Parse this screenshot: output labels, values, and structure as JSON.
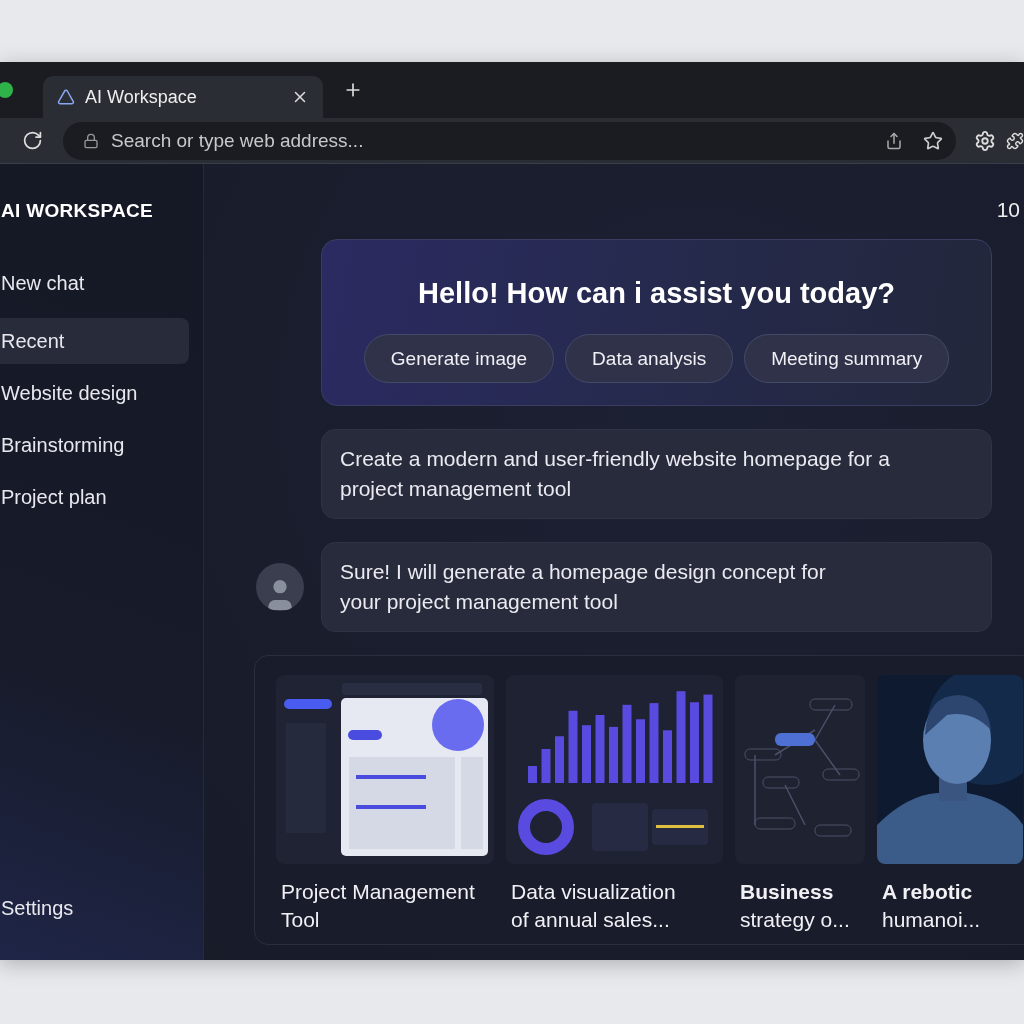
{
  "browser": {
    "tab": {
      "title": "AI Workspace",
      "selected": true
    },
    "address_bar": {
      "placeholder": "Search or type web address..."
    }
  },
  "sidebar": {
    "title": "AI WORKSPACE",
    "items": [
      {
        "label": "New chat",
        "selected": false
      },
      {
        "label": "Recent",
        "selected": true
      },
      {
        "label": "Website design",
        "selected": false
      },
      {
        "label": "Brainstorming",
        "selected": false
      },
      {
        "label": "Project plan",
        "selected": false
      }
    ],
    "footer_item": {
      "label": "Settings",
      "selected": false
    }
  },
  "header": {
    "counter": "10"
  },
  "hero": {
    "title": "Hello! How can i assist you today?",
    "suggestions": [
      "Generate image",
      "Data analysis",
      "Meeting summary"
    ]
  },
  "messages": [
    {
      "kind": "user",
      "lines": [
        "Create a modern and user-friendly website homepage for a",
        "project management tool"
      ]
    },
    {
      "kind": "assistant",
      "lines": [
        "Sure! I will generate a homepage design concept for",
        "your project management tool"
      ]
    }
  ],
  "gallery": [
    {
      "kind": "dashboard",
      "lines": [
        "Project Management",
        "Tool"
      ]
    },
    {
      "kind": "chart",
      "lines": [
        "Data visualization",
        "of annual sales..."
      ]
    },
    {
      "kind": "diagram",
      "lines": [
        "**Business**",
        "strategy o..."
      ]
    },
    {
      "kind": "figure",
      "lines": [
        "**A rebotic**",
        "humanoi..."
      ]
    }
  ]
}
